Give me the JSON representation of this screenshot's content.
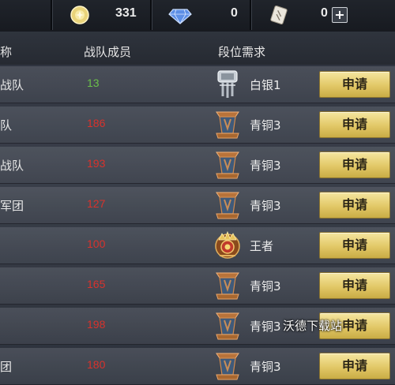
{
  "currency": {
    "gold": "331",
    "diamond": "0",
    "ticket": "0",
    "plus": "+"
  },
  "header": {
    "name_col": "称",
    "members_col": "战队成员",
    "rank_col": "段位需求"
  },
  "rows": [
    {
      "name": "战队",
      "count": "13",
      "count_color": "#6bc04a",
      "rank": "白银1",
      "rank_icon": "silver-rank-icon",
      "apply": "申请"
    },
    {
      "name": "队",
      "count": "186",
      "count_color": "#d8322c",
      "rank": "青铜3",
      "rank_icon": "bronze-rank-icon",
      "apply": "申请"
    },
    {
      "name": "战队",
      "count": "193",
      "count_color": "#d8322c",
      "rank": "青铜3",
      "rank_icon": "bronze-rank-icon",
      "apply": "申请"
    },
    {
      "name": "军团",
      "count": "127",
      "count_color": "#d8322c",
      "rank": "青铜3",
      "rank_icon": "bronze-rank-icon",
      "apply": "申请"
    },
    {
      "name": "",
      "count": "100",
      "count_color": "#d8322c",
      "rank": "王者",
      "rank_icon": "king-rank-icon",
      "apply": "申请"
    },
    {
      "name": "",
      "count": "165",
      "count_color": "#d8322c",
      "rank": "青铜3",
      "rank_icon": "bronze-rank-icon",
      "apply": "申请"
    },
    {
      "name": "",
      "count": "198",
      "count_color": "#d8322c",
      "rank": "青铜3",
      "rank_icon": "bronze-rank-icon",
      "apply": "申请"
    },
    {
      "name": "团",
      "count": "180",
      "count_color": "#d8322c",
      "rank": "青铜3",
      "rank_icon": "bronze-rank-icon",
      "apply": "申请"
    }
  ],
  "watermark": "沃德下载站"
}
